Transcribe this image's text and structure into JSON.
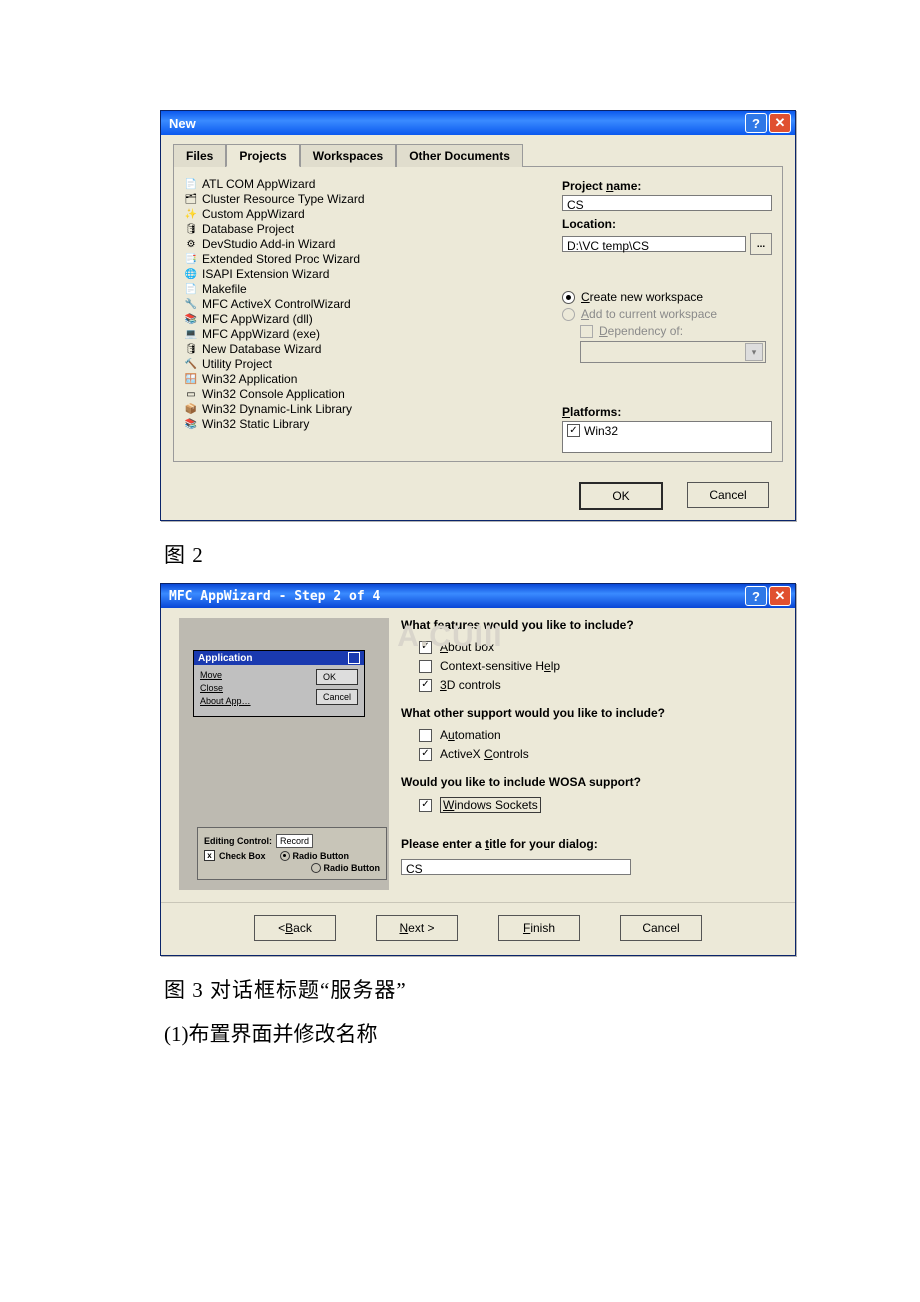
{
  "captions": {
    "fig2": "图 2",
    "fig3": "图 3      对话框标题“服务器”",
    "line1": "(1)布置界面并修改名称"
  },
  "watermark": "WWW.UUUCA.CUIII",
  "dialog1": {
    "title": "New",
    "tabs": [
      "Files",
      "Projects",
      "Workspaces",
      "Other Documents"
    ],
    "projects": [
      "ATL COM AppWizard",
      "Cluster Resource Type Wizard",
      "Custom AppWizard",
      "Database Project",
      "DevStudio Add-in Wizard",
      "Extended Stored Proc Wizard",
      "ISAPI Extension Wizard",
      "Makefile",
      "MFC ActiveX ControlWizard",
      "MFC AppWizard (dll)",
      "MFC AppWizard (exe)",
      "New Database Wizard",
      "Utility Project",
      "Win32 Application",
      "Win32 Console Application",
      "Win32 Dynamic-Link Library",
      "Win32 Static Library"
    ],
    "labels": {
      "project_name": "Project name:",
      "location": "Location:",
      "create_ws": "Create new workspace",
      "add_ws": "Add to current workspace",
      "dependency": "Dependency of:",
      "platforms": "Platforms:"
    },
    "values": {
      "project_name": "CS",
      "location": "D:\\VC temp\\CS",
      "platform": "Win32"
    },
    "buttons": {
      "ok": "OK",
      "cancel": "Cancel",
      "browse": "..."
    }
  },
  "dialog2": {
    "title": "MFC AppWizard - Step 2 of 4",
    "headers": {
      "features": "What features would you like to include?",
      "support": "What other support would you like to include?",
      "wosa": "Would you like to include WOSA support?",
      "title_prompt": "Please enter a title for your dialog:"
    },
    "options": {
      "about": "About box",
      "context_help": "Context-sensitive Help",
      "controls_3d": "3D controls",
      "automation": "Automation",
      "activex": "ActiveX Controls",
      "win_sockets": "Windows Sockets"
    },
    "title_value": "CS",
    "preview": {
      "app_title": "Application",
      "menu": [
        "Move",
        "Close",
        "About App…"
      ],
      "ok": "OK",
      "cancel": "Cancel",
      "editing_control": "Editing Control:",
      "record": "Record",
      "check_box": "Check Box",
      "radio_button": "Radio Button"
    },
    "buttons": {
      "back": "< Back",
      "next": "Next >",
      "finish": "Finish",
      "cancel": "Cancel"
    }
  }
}
